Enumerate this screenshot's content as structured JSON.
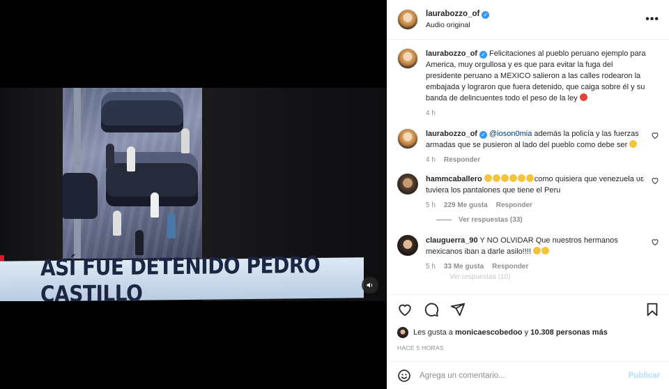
{
  "media": {
    "banner_text": "ASÍ FUE DETENIDO PEDRO CASTILLO",
    "volume_icon": "volume-icon"
  },
  "header": {
    "username": "laurabozzo_of",
    "subtitle": "Audio original",
    "more_icon": "more-options-icon"
  },
  "caption": {
    "username": "laurabozzo_of",
    "text": "Felicitaciones al pueblo peruano ejemplo para America, muy orgullosa y es que para evitar la fuga del presidente peruano a MEXICO salieron a las calles rodearon la embajada y lograron que fuera detenido, que caiga sobre él y su banda de delincuentes todo el peso de la ley",
    "time": "4 h"
  },
  "comments": [
    {
      "username": "laurabozzo_of",
      "mention": "@ioson0mia",
      "text": " además la policía y las fuerzas armadas que se pusieron al lado del pueblo como debe ser",
      "time": "4 h",
      "reply_label": "Responder"
    },
    {
      "username": "hammcaballero",
      "text": "como quisiera que venezuela ʋɛ tuviera los pantalones que tiene el Peru",
      "time": "5 h",
      "likes": "229 Me gusta",
      "reply_label": "Responder",
      "view_replies": "Ver respuestas (33)"
    },
    {
      "username": "clauguerra_90",
      "text": "Y NO OLVIDAR Que nuestros hermanos mexicanos iban a darle asilo!!!!",
      "time": "5 h",
      "likes": "33 Me gusta",
      "reply_label": "Responder",
      "view_replies_partial": "Ver respuestas (10)"
    }
  ],
  "actions": {
    "icons": [
      "heart-icon",
      "comment-icon",
      "share-icon",
      "bookmark-icon"
    ],
    "likes_prefix": "Les gusta a ",
    "likes_user": "monicaescobedoo",
    "likes_middle": " y ",
    "likes_count": "10.308 personas más",
    "timestamp": "HACE 5 HORAS"
  },
  "add_comment": {
    "placeholder": "Agrega un comentario...",
    "publish_label": "Publicar"
  },
  "colors": {
    "verified": "#3897f0",
    "publish": "#b2dffc",
    "muted": "#8e8e8e",
    "mention": "#00376b"
  }
}
